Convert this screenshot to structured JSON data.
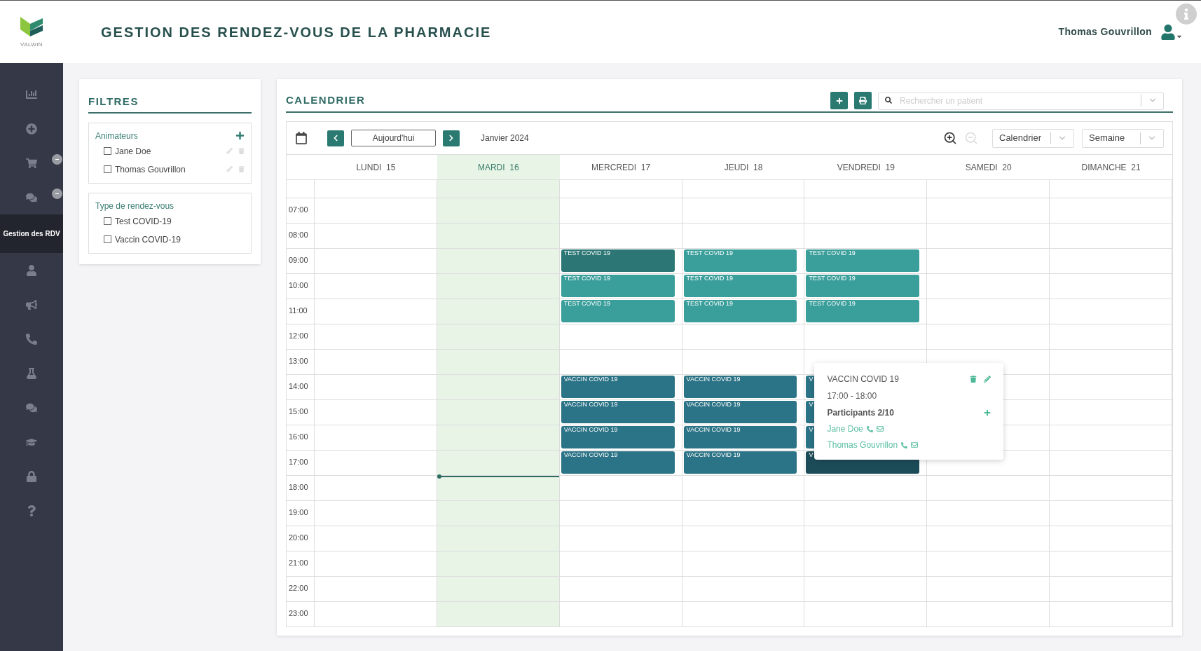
{
  "header": {
    "logo_text": "VALWIN",
    "title": "GESTION DES RENDEZ-VOUS DE LA PHARMACIE",
    "user_name": "Thomas Gouvrillon"
  },
  "sidebar": {
    "items": [
      {
        "selected": false,
        "badge": false
      },
      {
        "selected": false,
        "badge": false
      },
      {
        "selected": false,
        "badge": true
      },
      {
        "selected": false,
        "badge": true
      },
      {
        "label": "Gestion des RDV",
        "selected": true,
        "badge": false
      },
      {
        "selected": false,
        "badge": false
      },
      {
        "selected": false,
        "badge": false
      },
      {
        "selected": false,
        "badge": false
      },
      {
        "selected": false,
        "badge": false
      },
      {
        "selected": false,
        "badge": false
      },
      {
        "selected": false,
        "badge": false
      },
      {
        "selected": false,
        "badge": false
      },
      {
        "selected": false,
        "badge": false
      }
    ]
  },
  "filters": {
    "title": "FILTRES",
    "groups": [
      {
        "title": "Animateurs",
        "addable": true,
        "items": [
          {
            "label": "Jane Doe",
            "checked": false,
            "editable": true
          },
          {
            "label": "Thomas Gouvrillon",
            "checked": false,
            "editable": true
          }
        ]
      },
      {
        "title": "Type de rendez-vous",
        "addable": false,
        "items": [
          {
            "label": "Test COVID-19",
            "checked": false,
            "editable": false
          },
          {
            "label": "Vaccin COVID-19",
            "checked": false,
            "editable": false
          }
        ]
      }
    ]
  },
  "calendar": {
    "title": "CALENDRIER",
    "search": {
      "placeholder": "Rechercher un patient"
    },
    "today_button": "Aujourd'hui",
    "period": "Janvier 2024",
    "zoom_out_disabled": true,
    "view_select": "Calendrier",
    "range_select": "Semaine",
    "days": [
      {
        "label": "LUNDI  15",
        "selected": false
      },
      {
        "label": "MARDI  16",
        "selected": true
      },
      {
        "label": "MERCREDI  17",
        "selected": false
      },
      {
        "label": "JEUDI  18",
        "selected": false
      },
      {
        "label": "VENDREDI  19",
        "selected": false
      },
      {
        "label": "SAMEDI  20",
        "selected": false
      },
      {
        "label": "DIMANCHE  21",
        "selected": false
      }
    ],
    "rows": [
      {},
      {
        "time": "07:00"
      },
      {
        "time": "08:00"
      },
      {
        "time": "09:00",
        "events": [
          {
            "kind": "empty"
          },
          {
            "kind": "empty"
          },
          {
            "kind": "test",
            "label": "TEST COVID 19",
            "hover": true,
            "selected": false
          },
          {
            "kind": "test",
            "label": "TEST COVID 19",
            "hover": false,
            "selected": false
          },
          {
            "kind": "test",
            "label": "TEST COVID 19",
            "hover": false,
            "selected": false
          },
          {
            "kind": "empty"
          },
          {
            "kind": "empty"
          }
        ]
      },
      {
        "time": "10:00",
        "events": [
          {
            "kind": "empty"
          },
          {
            "kind": "empty"
          },
          {
            "kind": "test",
            "label": "TEST COVID 19",
            "hover": false,
            "selected": false
          },
          {
            "kind": "test",
            "label": "TEST COVID 19",
            "hover": false,
            "selected": false
          },
          {
            "kind": "test",
            "label": "TEST COVID 19",
            "hover": false,
            "selected": false
          },
          {
            "kind": "empty"
          },
          {
            "kind": "empty"
          }
        ]
      },
      {
        "time": "11:00",
        "events": [
          {
            "kind": "empty"
          },
          {
            "kind": "empty"
          },
          {
            "kind": "test",
            "label": "TEST COVID 19",
            "hover": false,
            "selected": false
          },
          {
            "kind": "test",
            "label": "TEST COVID 19",
            "hover": false,
            "selected": false
          },
          {
            "kind": "test",
            "label": "TEST COVID 19",
            "hover": false,
            "selected": false
          },
          {
            "kind": "empty"
          },
          {
            "kind": "empty"
          }
        ]
      },
      {
        "time": "12:00"
      },
      {
        "time": "13:00"
      },
      {
        "time": "14:00",
        "events": [
          {
            "kind": "empty"
          },
          {
            "kind": "empty"
          },
          {
            "kind": "vaccin",
            "label": "VACCIN COVID 19",
            "hover": false,
            "selected": false
          },
          {
            "kind": "vaccin",
            "label": "VACCIN COVID 19",
            "hover": false,
            "selected": false
          },
          {
            "kind": "vaccin",
            "label": "V",
            "hover": false,
            "selected": false
          },
          {
            "kind": "empty"
          },
          {
            "kind": "empty"
          }
        ]
      },
      {
        "time": "15:00",
        "events": [
          {
            "kind": "empty"
          },
          {
            "kind": "empty"
          },
          {
            "kind": "vaccin",
            "label": "VACCIN COVID 19",
            "hover": false,
            "selected": false
          },
          {
            "kind": "vaccin",
            "label": "VACCIN COVID 19",
            "hover": false,
            "selected": false
          },
          {
            "kind": "vaccin",
            "label": "V",
            "hover": false,
            "selected": false
          },
          {
            "kind": "empty"
          },
          {
            "kind": "empty"
          }
        ]
      },
      {
        "time": "16:00",
        "events": [
          {
            "kind": "empty"
          },
          {
            "kind": "empty"
          },
          {
            "kind": "vaccin",
            "label": "VACCIN COVID 19",
            "hover": false,
            "selected": false
          },
          {
            "kind": "vaccin",
            "label": "VACCIN COVID 19",
            "hover": false,
            "selected": false
          },
          {
            "kind": "vaccin",
            "label": "V",
            "hover": false,
            "selected": false
          },
          {
            "kind": "empty"
          },
          {
            "kind": "empty"
          }
        ]
      },
      {
        "time": "17:00",
        "events": [
          {
            "kind": "empty"
          },
          {
            "kind": "empty"
          },
          {
            "kind": "vaccin",
            "label": "VACCIN COVID 19",
            "hover": false,
            "selected": false
          },
          {
            "kind": "vaccin",
            "label": "VACCIN COVID 19",
            "hover": false,
            "selected": false
          },
          {
            "kind": "vaccin",
            "label": "V",
            "hover": false,
            "selected": true
          },
          {
            "kind": "empty"
          },
          {
            "kind": "empty"
          }
        ]
      },
      {
        "time": "18:00",
        "now_line": true
      },
      {
        "time": "19:00"
      },
      {
        "time": "20:00"
      },
      {
        "time": "21:00"
      },
      {
        "time": "22:00"
      },
      {
        "time": "23:00"
      }
    ],
    "popup": {
      "title": "VACCIN COVID 19",
      "time": "17:00 - 18:00",
      "participants_label": "Participants 2/10",
      "participants": [
        {
          "name": "Jane Doe"
        },
        {
          "name": "Thomas Gouvrillon"
        }
      ]
    }
  }
}
